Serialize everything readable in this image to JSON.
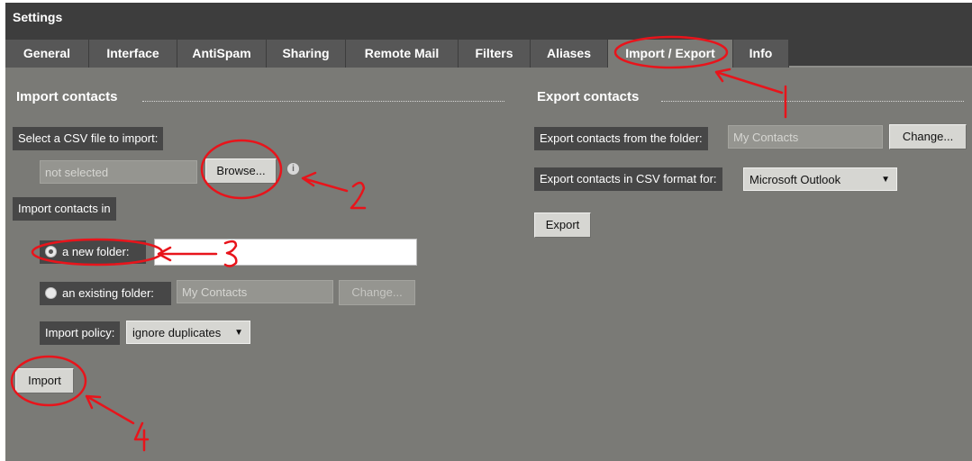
{
  "window": {
    "title": "Settings"
  },
  "tabs": [
    {
      "label": "General"
    },
    {
      "label": "Interface"
    },
    {
      "label": "AntiSpam"
    },
    {
      "label": "Sharing"
    },
    {
      "label": "Remote Mail"
    },
    {
      "label": "Filters"
    },
    {
      "label": "Aliases"
    },
    {
      "label": "Import / Export",
      "active": true
    },
    {
      "label": "Info"
    }
  ],
  "import": {
    "title": "Import contacts",
    "select_file_label": "Select a CSV file to import:",
    "file_value": "not selected",
    "browse_label": "Browse...",
    "import_in_label": "Import contacts in",
    "new_folder_label": "a new folder:",
    "new_folder_value": "",
    "existing_folder_label": "an existing folder:",
    "existing_folder_value": "My Contacts",
    "change_label": "Change...",
    "policy_label": "Import policy:",
    "policy_value": "ignore duplicates",
    "import_button": "Import"
  },
  "export": {
    "title": "Export contacts",
    "from_folder_label": "Export contacts from the folder:",
    "from_folder_value": "My Contacts",
    "change_label": "Change...",
    "format_label": "Export contacts in CSV format for:",
    "format_value": "Microsoft Outlook",
    "export_button": "Export"
  },
  "annotations": {
    "color": "#e8141b",
    "numbers": [
      "1",
      "2",
      "3",
      "4"
    ]
  },
  "colors": {
    "background": "#7a7a76",
    "bar": "#3d3d3d",
    "tab": "#575757"
  }
}
